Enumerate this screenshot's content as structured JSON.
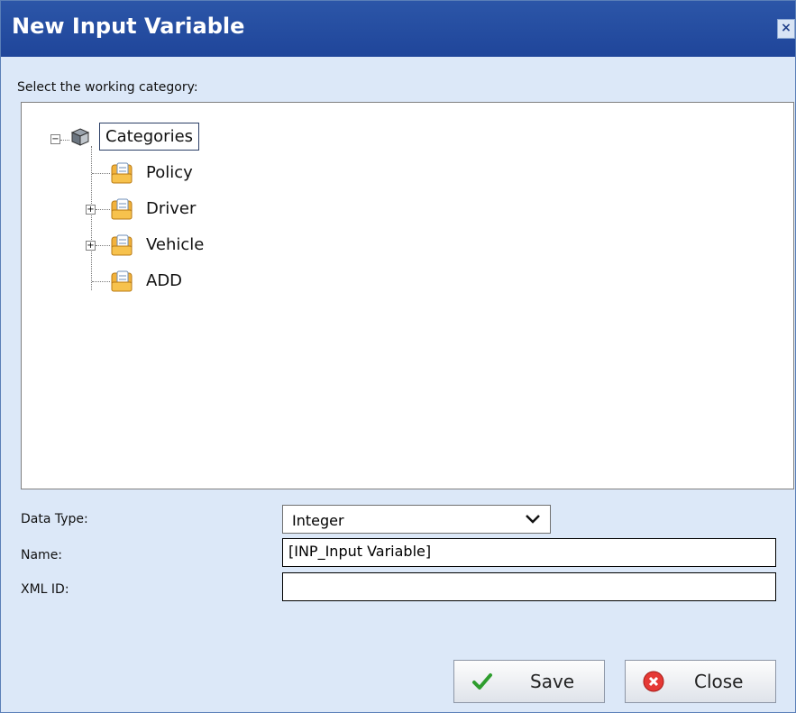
{
  "dialog": {
    "title": "New Input Variable",
    "close_glyph": "×"
  },
  "category_prompt": "Select the working category:",
  "tree": {
    "root": {
      "label": "Categories",
      "icon": "cube-icon",
      "expanded": true
    },
    "children": [
      {
        "label": "Policy",
        "icon": "folder-icon",
        "expandable": false
      },
      {
        "label": "Driver",
        "icon": "folder-icon",
        "expandable": true
      },
      {
        "label": "Vehicle",
        "icon": "folder-icon",
        "expandable": true
      },
      {
        "label": "ADD",
        "icon": "folder-icon",
        "expandable": false
      }
    ]
  },
  "fields": {
    "data_type": {
      "label": "Data Type:",
      "value": "Integer"
    },
    "name": {
      "label": "Name:",
      "value": "[INP_Input Variable]"
    },
    "xml_id": {
      "label": "XML ID:",
      "value": ""
    }
  },
  "buttons": {
    "save": {
      "label": "Save",
      "icon": "check-icon"
    },
    "close": {
      "label": "Close",
      "icon": "close-circle-icon"
    }
  },
  "colors": {
    "titlebar": "#2c56a8",
    "client": "#dce8f8",
    "accent": "#1f459a"
  }
}
